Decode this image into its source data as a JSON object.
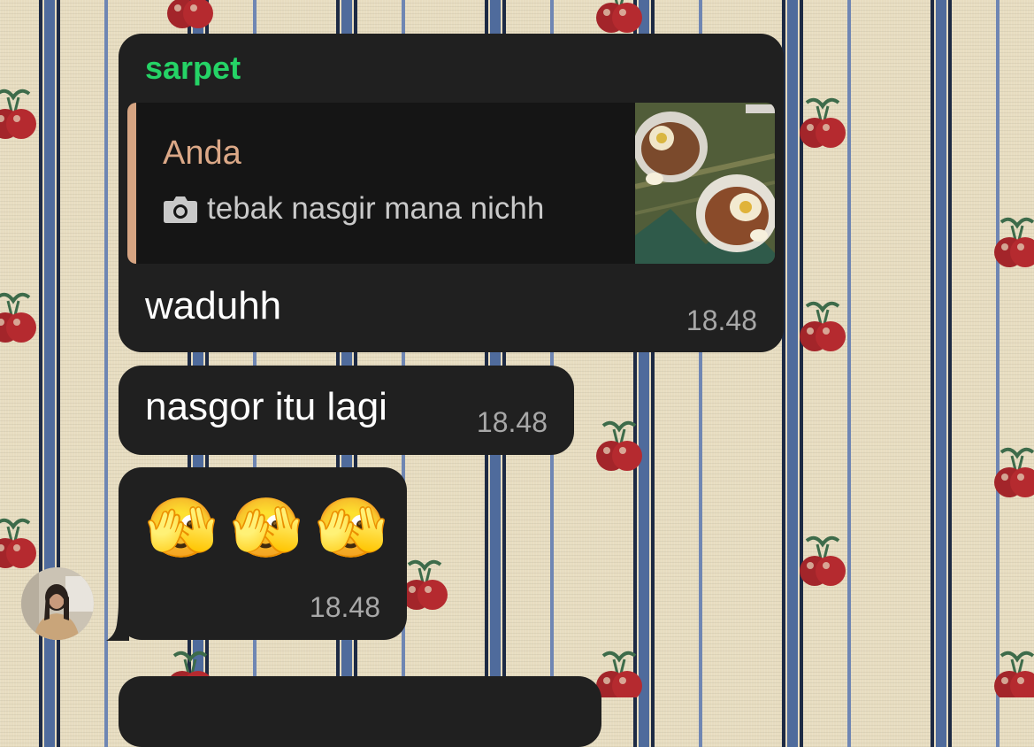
{
  "chat": {
    "messages": [
      {
        "sender": "sarpet",
        "sender_color": "#25d366",
        "reply_to": {
          "author": "Anda",
          "author_color": "#dba887",
          "icon": "camera-icon",
          "caption": "tebak nasgir mana nichh",
          "thumbnail": "photo-thumbnail"
        },
        "text": "waduhh",
        "time": "18.48"
      },
      {
        "text": "nasgor itu lagi",
        "time": "18.48"
      },
      {
        "text": "🫣🫣🫣",
        "time": "18.48"
      }
    ],
    "avatar": "contact-avatar"
  },
  "colors": {
    "bubble_bg": "#202020",
    "quote_bg": "#151515",
    "quote_bar": "#d6a482",
    "timestamp": "#a8a8a8"
  }
}
